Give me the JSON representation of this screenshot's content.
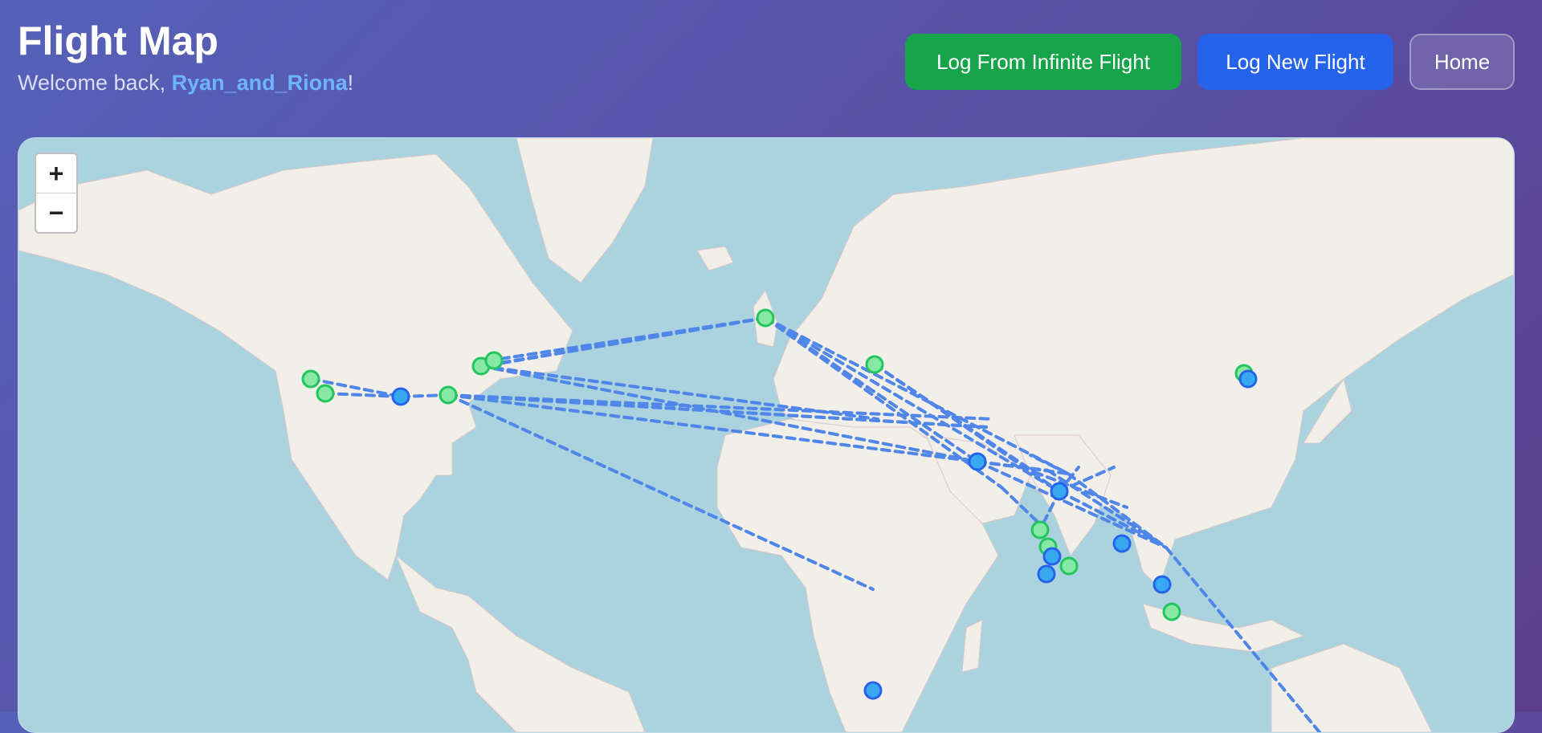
{
  "header": {
    "title": "Flight Map",
    "welcome_prefix": "Welcome back, ",
    "username": "Ryan_and_Riona",
    "welcome_suffix": "!"
  },
  "actions": {
    "infinite_flight_label": "Log From Infinite Flight",
    "new_flight_label": "Log New Flight",
    "home_label": "Home"
  },
  "map": {
    "zoom_in_label": "+",
    "zoom_out_label": "−",
    "colors": {
      "ocean": "#aad3df",
      "land": "#f2efe9",
      "route": "#4f86e8",
      "origin_marker": "#86e8a4",
      "origin_stroke": "#22c55e",
      "dest_marker": "#38a9f0",
      "dest_stroke": "#2563eb"
    }
  }
}
